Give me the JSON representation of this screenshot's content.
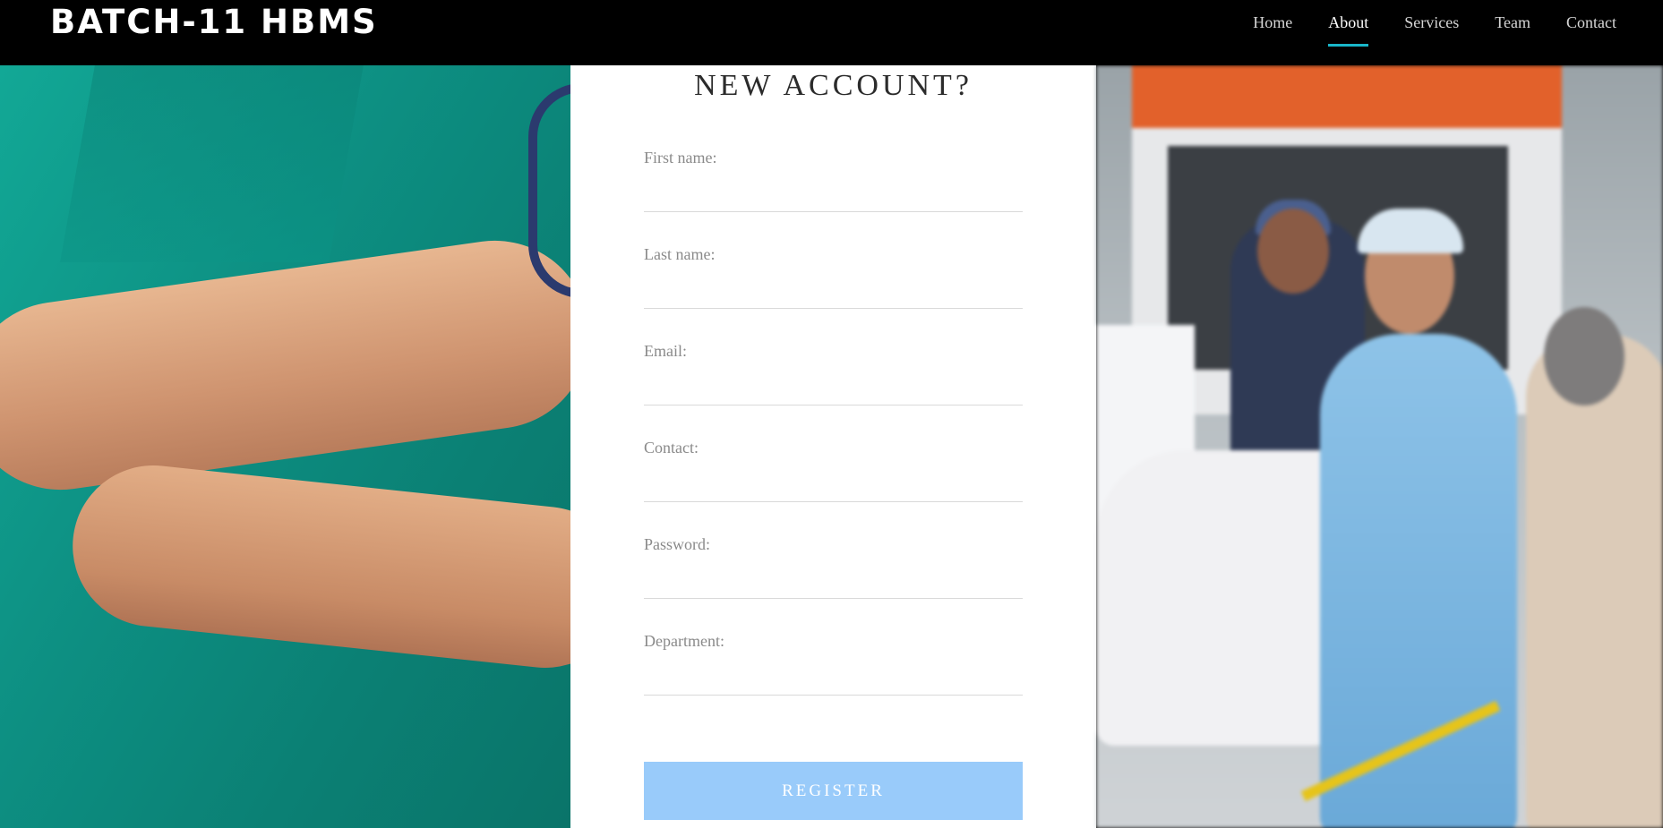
{
  "brand": "BATCH-11 HBMS",
  "nav": {
    "items": [
      {
        "label": "Home",
        "active": false
      },
      {
        "label": "About",
        "active": true
      },
      {
        "label": "Services",
        "active": false
      },
      {
        "label": "Team",
        "active": false
      },
      {
        "label": "Contact",
        "active": false
      }
    ]
  },
  "form": {
    "title": "NEW ACCOUNT?",
    "fields": [
      {
        "label": "First name:",
        "value": ""
      },
      {
        "label": "Last name:",
        "value": ""
      },
      {
        "label": "Email:",
        "value": ""
      },
      {
        "label": "Contact:",
        "value": ""
      },
      {
        "label": "Password:",
        "value": ""
      },
      {
        "label": "Department:",
        "value": ""
      }
    ],
    "submit_label": "REGISTER"
  },
  "colors": {
    "nav_background": "#000000",
    "nav_active_underline": "#19b6c9",
    "register_button": "#99cbfa",
    "panel_background": "#ffffff"
  }
}
